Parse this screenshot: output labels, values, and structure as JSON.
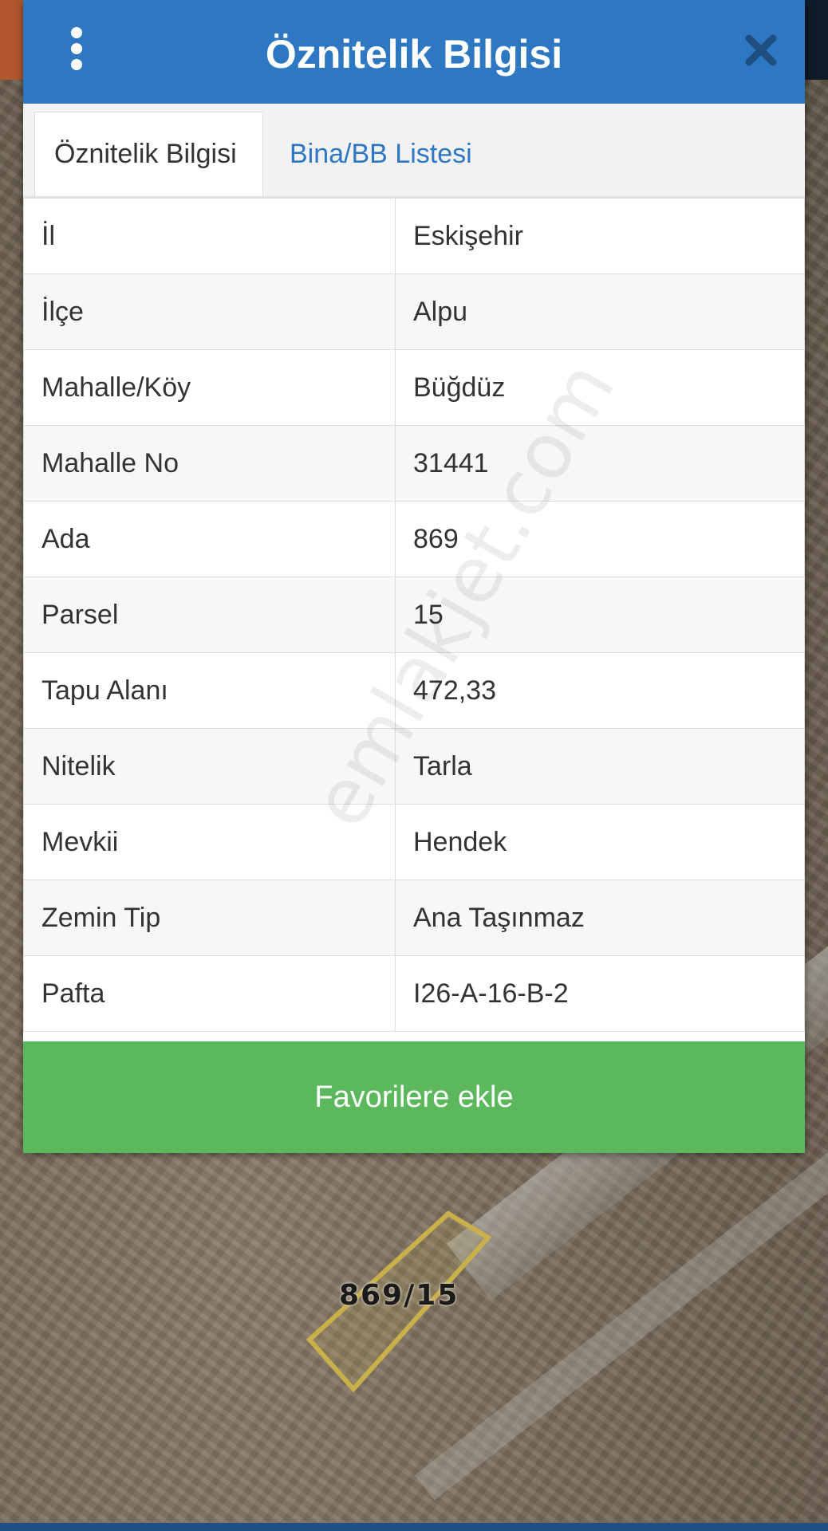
{
  "header": {
    "title": "Öznitelik Bilgisi"
  },
  "tabs": [
    {
      "label": "Öznitelik Bilgisi",
      "active": true
    },
    {
      "label": "Bina/BB Listesi",
      "active": false
    }
  ],
  "attributes": [
    {
      "label": "İl",
      "value": "Eskişehir"
    },
    {
      "label": "İlçe",
      "value": "Alpu"
    },
    {
      "label": "Mahalle/Köy",
      "value": "Büğdüz"
    },
    {
      "label": "Mahalle No",
      "value": "31441"
    },
    {
      "label": "Ada",
      "value": "869"
    },
    {
      "label": "Parsel",
      "value": "15"
    },
    {
      "label": "Tapu Alanı",
      "value": "472,33"
    },
    {
      "label": "Nitelik",
      "value": "Tarla"
    },
    {
      "label": "Mevkii",
      "value": "Hendek"
    },
    {
      "label": "Zemin Tip",
      "value": "Ana Taşınmaz"
    },
    {
      "label": "Pafta",
      "value": "I26-A-16-B-2"
    }
  ],
  "actions": {
    "favorite_label": "Favorilere ekle"
  },
  "map": {
    "parcel_label": "869/15"
  },
  "watermark": "emlakjet.com",
  "icons": {
    "menu": "more-vertical-icon",
    "close": "close-icon"
  },
  "colors": {
    "header": "#2e77c2",
    "favorite_button": "#5cb85c",
    "tab_link": "#2e77c2"
  }
}
